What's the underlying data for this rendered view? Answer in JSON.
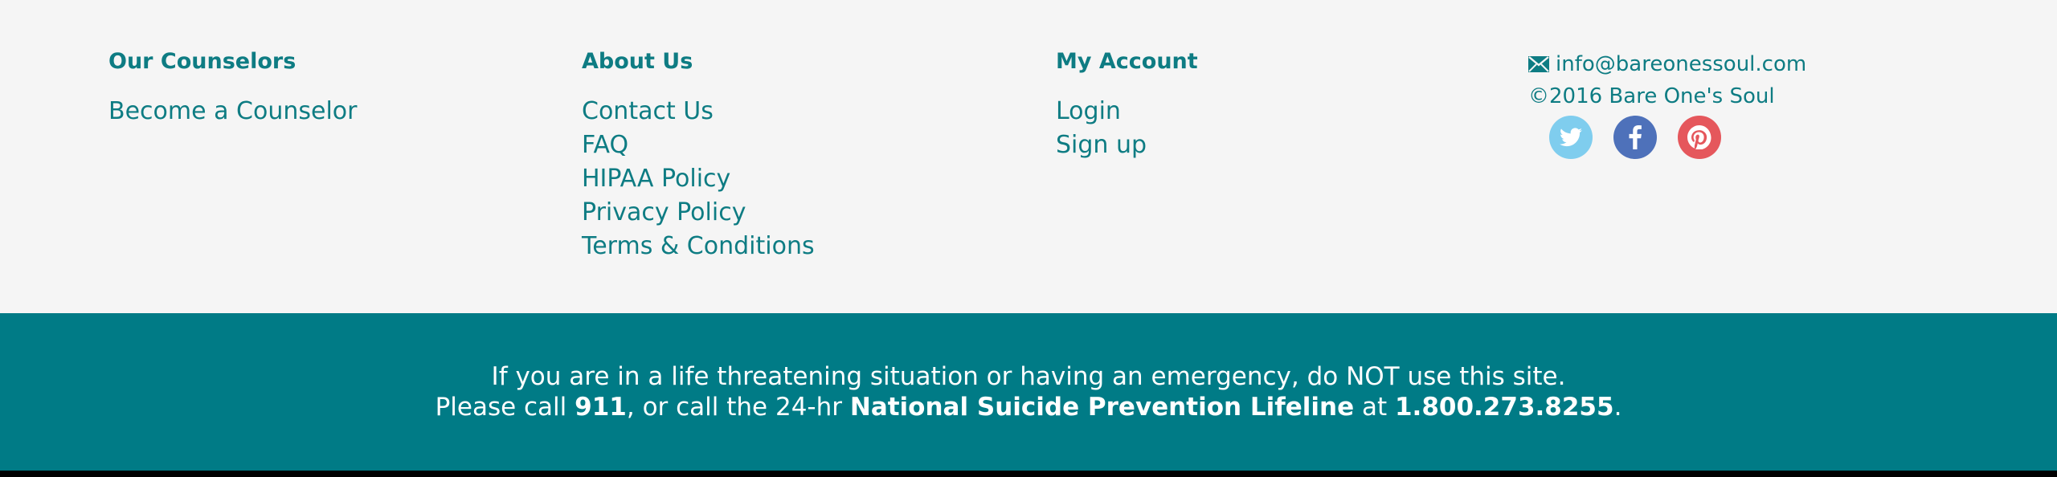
{
  "columns": {
    "counselors": {
      "heading": "Our Counselors",
      "links": [
        "Become a Counselor"
      ]
    },
    "about": {
      "heading": "About Us",
      "links": [
        "Contact Us",
        "FAQ",
        "HIPAA Policy",
        "Privacy Policy",
        "Terms & Conditions"
      ]
    },
    "account": {
      "heading": "My Account",
      "links": [
        "Login",
        "Sign up"
      ]
    }
  },
  "contact": {
    "email": "info@bareonessoul.com",
    "copyright": "©2016 Bare One's Soul",
    "social": [
      {
        "name": "twitter-icon",
        "color": "#7fcdee"
      },
      {
        "name": "facebook-icon",
        "color": "#4e71ba"
      },
      {
        "name": "pinterest-icon",
        "color": "#e5575c"
      }
    ]
  },
  "notice": {
    "line1": "If you are in a life threatening situation or having an emergency, do NOT use this site.",
    "line2_pre": "Please call ",
    "line2_911": "911",
    "line2_mid": ", or call the 24-hr ",
    "line2_lifeline": "National Suicide Prevention Lifeline",
    "line2_at": " at ",
    "line2_phone": "1.800.273.8255",
    "line2_end": "."
  },
  "colors": {
    "accent": "#0e7c83",
    "banner": "#007b86",
    "background": "#f5f5f5"
  }
}
